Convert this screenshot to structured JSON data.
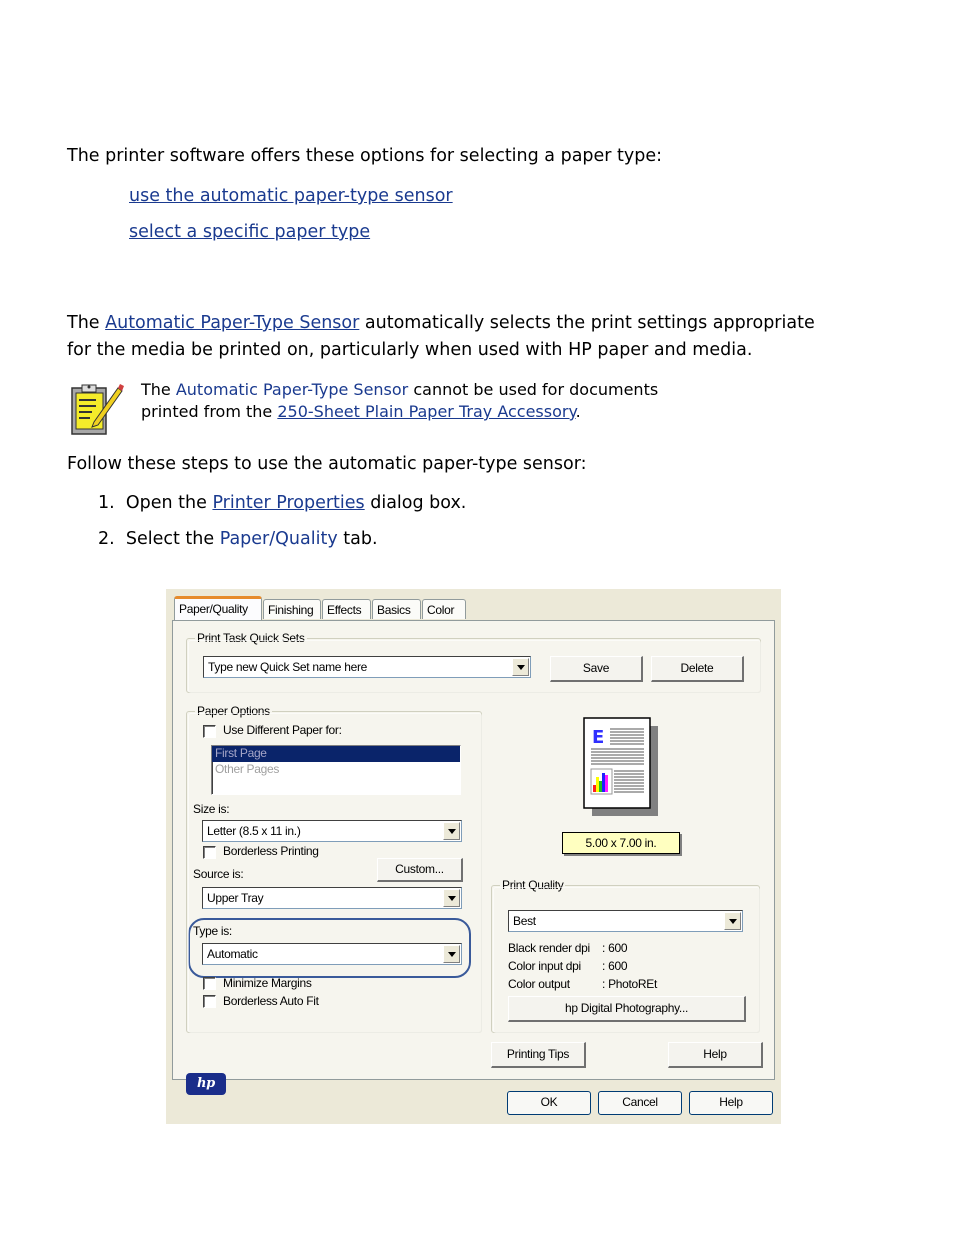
{
  "intro": "The printer software offers these options for selecting a paper type:",
  "options": [
    "use the automatic paper-type sensor",
    "select a specific paper type"
  ],
  "sensor_paragraph": {
    "prefix": "The ",
    "link": "Automatic Paper-Type Sensor",
    "suffix_line1": " automatically selects the print settings appropriate",
    "line2": "for the media be printed on, particularly when used with HP paper and media."
  },
  "note": {
    "icon": "note-clipboard-icon",
    "prefix": "The ",
    "term": "Automatic Paper-Type Sensor",
    "middle": " cannot be used for documents",
    "line2_prefix": "printed from the ",
    "link": "250-Sheet Plain Paper Tray Accessory",
    "line2_suffix": "."
  },
  "steps_intro": "Follow these steps to use the automatic paper-type sensor:",
  "steps": [
    {
      "num": "1.",
      "prefix": "Open the ",
      "link": "Printer Properties",
      "suffix": " dialog box."
    },
    {
      "num": "2.",
      "prefix": "Select the ",
      "term": "Paper/Quality",
      "suffix": " tab."
    }
  ],
  "dialog": {
    "tabs": [
      "Paper/Quality",
      "Finishing",
      "Effects",
      "Basics",
      "Color"
    ],
    "active_tab": "Paper/Quality",
    "quick_sets": {
      "legend": "Print Task Quick Sets",
      "value": "Type new Quick Set name here",
      "save": "Save",
      "delete": "Delete"
    },
    "paper_options": {
      "legend": "Paper Options",
      "use_different": "Use Different Paper for:",
      "use_different_checked": false,
      "pages": [
        "First Page",
        "Other Pages"
      ],
      "selected_page": "First Page",
      "size_label": "Size is:",
      "size_value": "Letter (8.5 x 11 in.)",
      "borderless": "Borderless Printing",
      "borderless_checked": false,
      "custom": "Custom...",
      "source_label": "Source is:",
      "source_value": "Upper Tray",
      "type_label": "Type is:",
      "type_value": "Automatic",
      "minimize_margins": "Minimize Margins",
      "borderless_autofit": "Borderless Auto Fit"
    },
    "preview_size": "5.00 x 7.00 in.",
    "print_quality": {
      "legend": "Print Quality",
      "value": "Best",
      "rows": [
        {
          "label": "Black render dpi",
          "value": ": 600"
        },
        {
          "label": "Color input dpi",
          "value": ": 600"
        },
        {
          "label": "Color output",
          "value": ": PhotoREt"
        }
      ],
      "digital_photo": "hp Digital Photography..."
    },
    "hp_logo": "hp",
    "printing_tips": "Printing Tips",
    "help_inner": "Help",
    "ok": "OK",
    "cancel": "Cancel",
    "help": "Help"
  }
}
